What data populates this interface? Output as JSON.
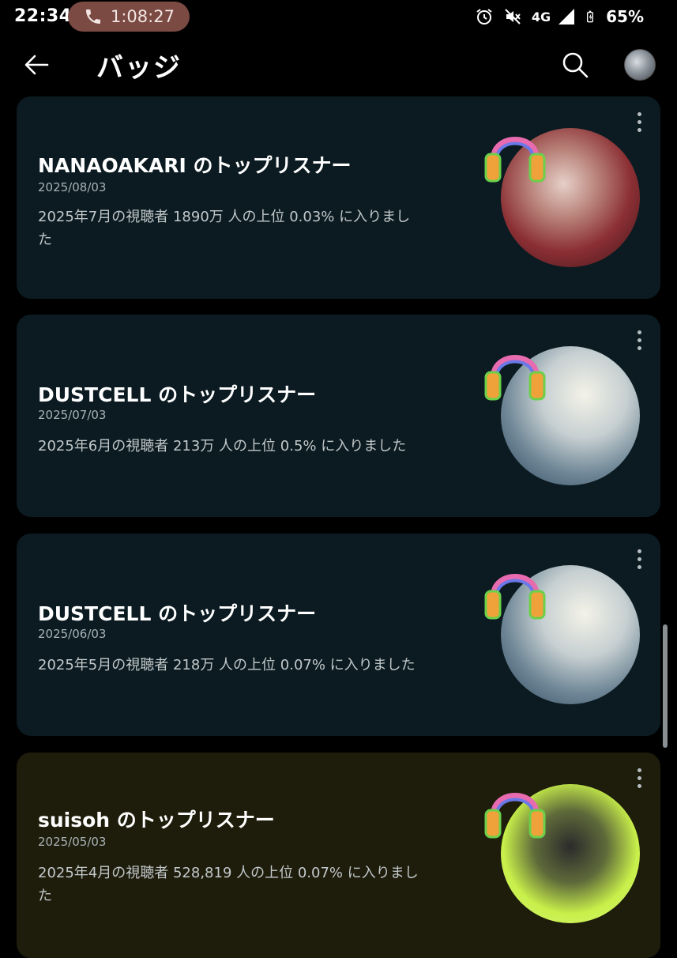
{
  "status_bar": {
    "time": "22:34",
    "call_timer": "1:08:27",
    "network": "4G",
    "battery": "65%"
  },
  "app_bar": {
    "title": "バッジ"
  },
  "badges": [
    {
      "title": "NANAOAKARI のトップリスナー",
      "date": "2025/08/03",
      "desc_line1": "2025年7月の視聴者 1890万 人の上位 0.03% に入りまし",
      "desc_line2": "た"
    },
    {
      "title": "DUSTCELL のトップリスナー",
      "date": "2025/07/03",
      "desc_line1": "2025年6月の視聴者 213万 人の上位 0.5% に入りました",
      "desc_line2": ""
    },
    {
      "title": "DUSTCELL のトップリスナー",
      "date": "2025/06/03",
      "desc_line1": "2025年5月の視聴者 218万 人の上位 0.07% に入りました",
      "desc_line2": ""
    },
    {
      "title": "suisoh のトップリスナー",
      "date": "2025/05/03",
      "desc_line1": "2025年4月の視聴者 528,819 人の上位 0.07% に入りまし",
      "desc_line2": "た"
    }
  ],
  "colors": {
    "background": "#000000",
    "card_dark": "#0b1b21",
    "card_olive": "#1e1d0c",
    "call_pill": "#7a4a43"
  },
  "icons": [
    "phone-icon",
    "alarm-icon",
    "mute-icon",
    "signal-icon",
    "battery-icon",
    "back-arrow-icon",
    "search-icon",
    "more-vert-icon",
    "headphones-icon"
  ]
}
